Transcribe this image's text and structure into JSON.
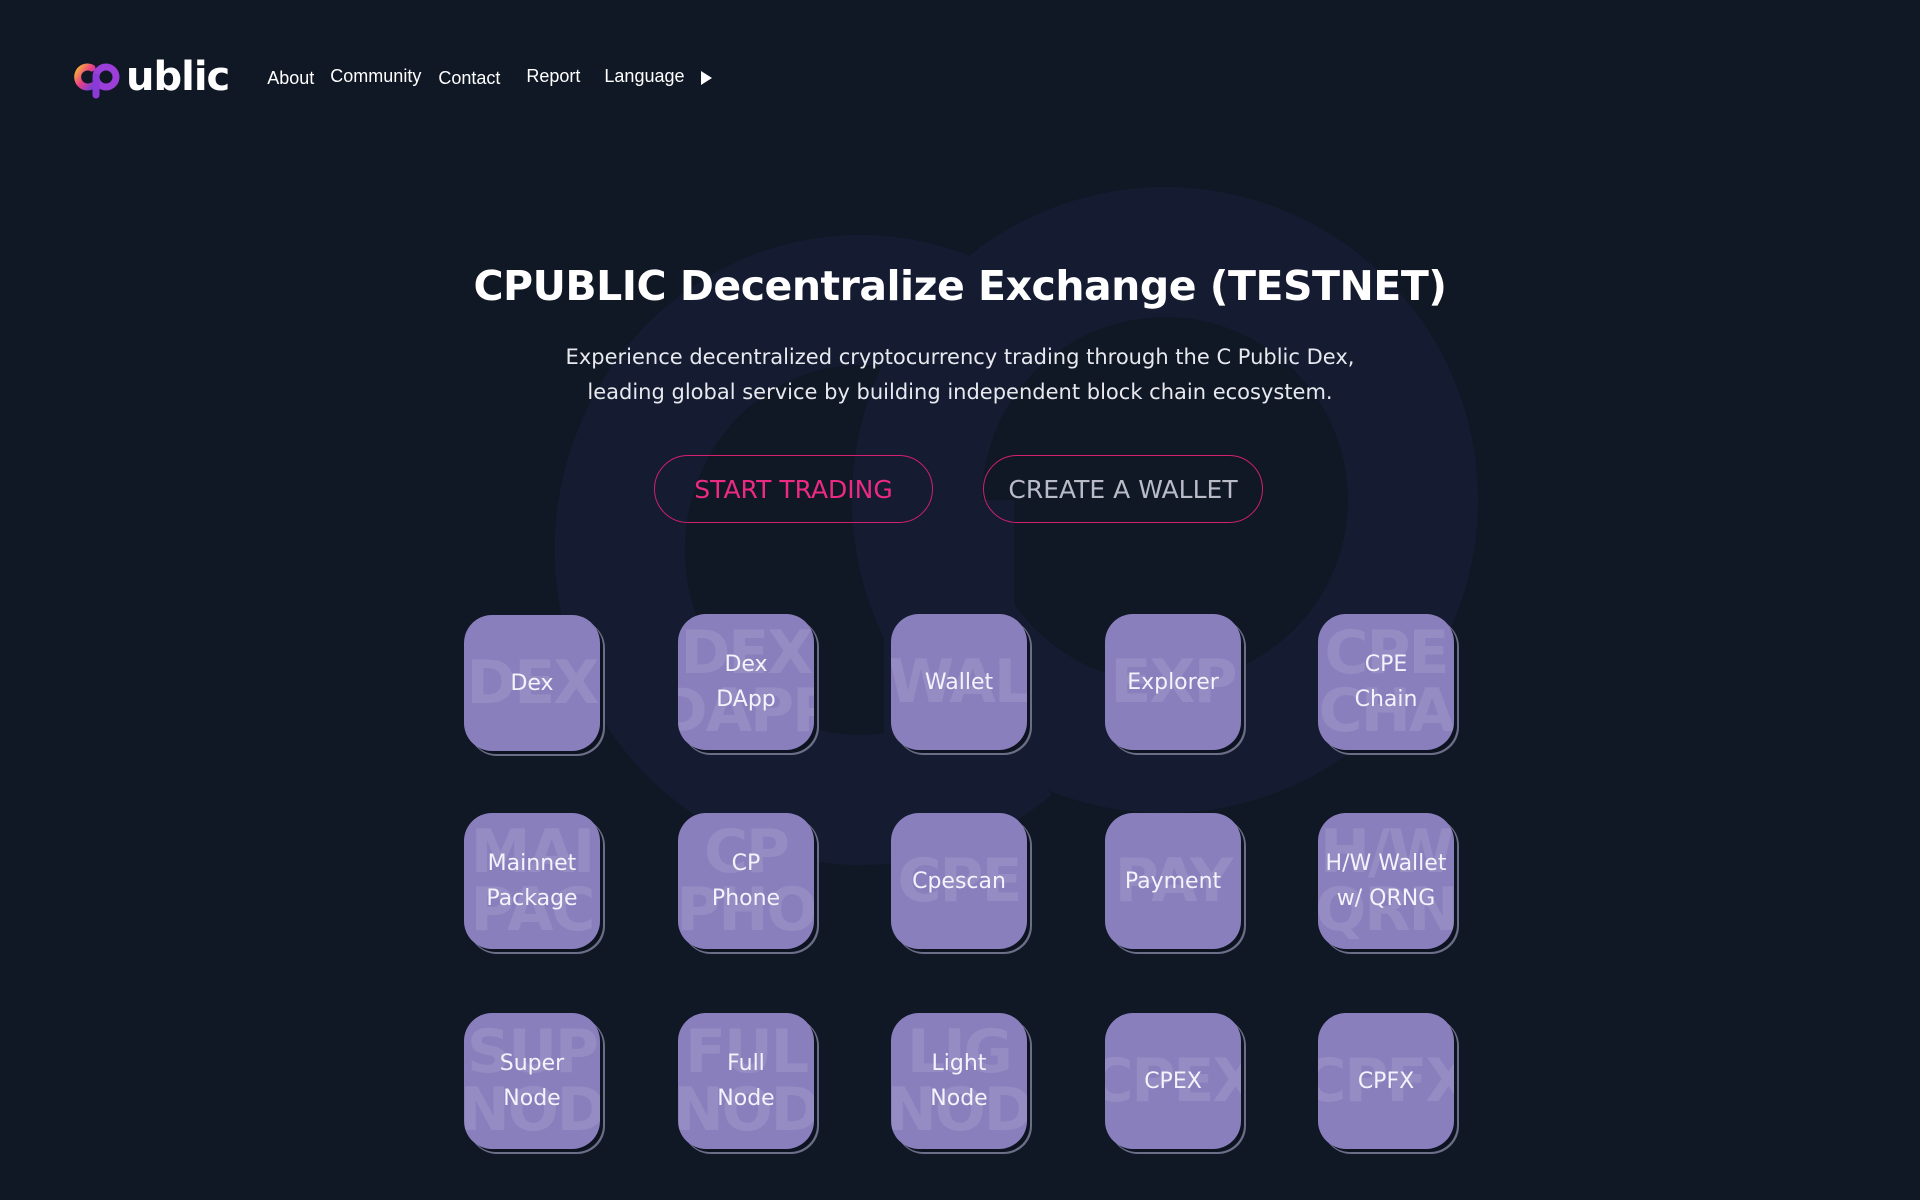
{
  "header": {
    "logo": {
      "mark": "cp-logo-icon",
      "text": "ublic"
    },
    "nav": [
      {
        "label": "About"
      },
      {
        "label": "Community"
      },
      {
        "label": "Contact"
      },
      {
        "label": "Report"
      },
      {
        "label": "Language",
        "icon": "triangle-right-icon"
      }
    ]
  },
  "hero": {
    "title": "CPUBLIC Decentralize Exchange (TESTNET)",
    "description_line1": "Experience decentralized cryptocurrency trading through the C Public Dex,",
    "description_line2": "leading global service by building independent block chain ecosystem.",
    "primary_button": "START TRADING",
    "secondary_button": "CREATE A WALLET"
  },
  "tiles": [
    {
      "label": "Dex",
      "watermark": "DEX"
    },
    {
      "label": "Dex\nDApp",
      "watermark": "DEX\nDAPP"
    },
    {
      "label": "Wallet",
      "watermark": "WAL"
    },
    {
      "label": "Explorer",
      "watermark": "EXP"
    },
    {
      "label": "CPE\nChain",
      "watermark": "CPE\nCHA"
    },
    {
      "label": "Mainnet\nPackage",
      "watermark": "MAI\nPAC"
    },
    {
      "label": "CP\nPhone",
      "watermark": "CP\nPHO"
    },
    {
      "label": "Cpescan",
      "watermark": "CPE"
    },
    {
      "label": "Payment",
      "watermark": "PAY"
    },
    {
      "label": "H/W Wallet\nw/ QRNG",
      "watermark": "H/W\nQRN"
    },
    {
      "label": "Super\nNode",
      "watermark": "SUP\nNOD"
    },
    {
      "label": "Full\nNode",
      "watermark": "FUL\nNOD"
    },
    {
      "label": "Light\nNode",
      "watermark": "LIG\nNOD"
    },
    {
      "label": "CPEX",
      "watermark": "CPEX"
    },
    {
      "label": "CPFX",
      "watermark": "CPFX"
    }
  ],
  "colors": {
    "background": "#101725",
    "accent_pink": "#ec2a83",
    "tile": "#8a7fbd"
  }
}
